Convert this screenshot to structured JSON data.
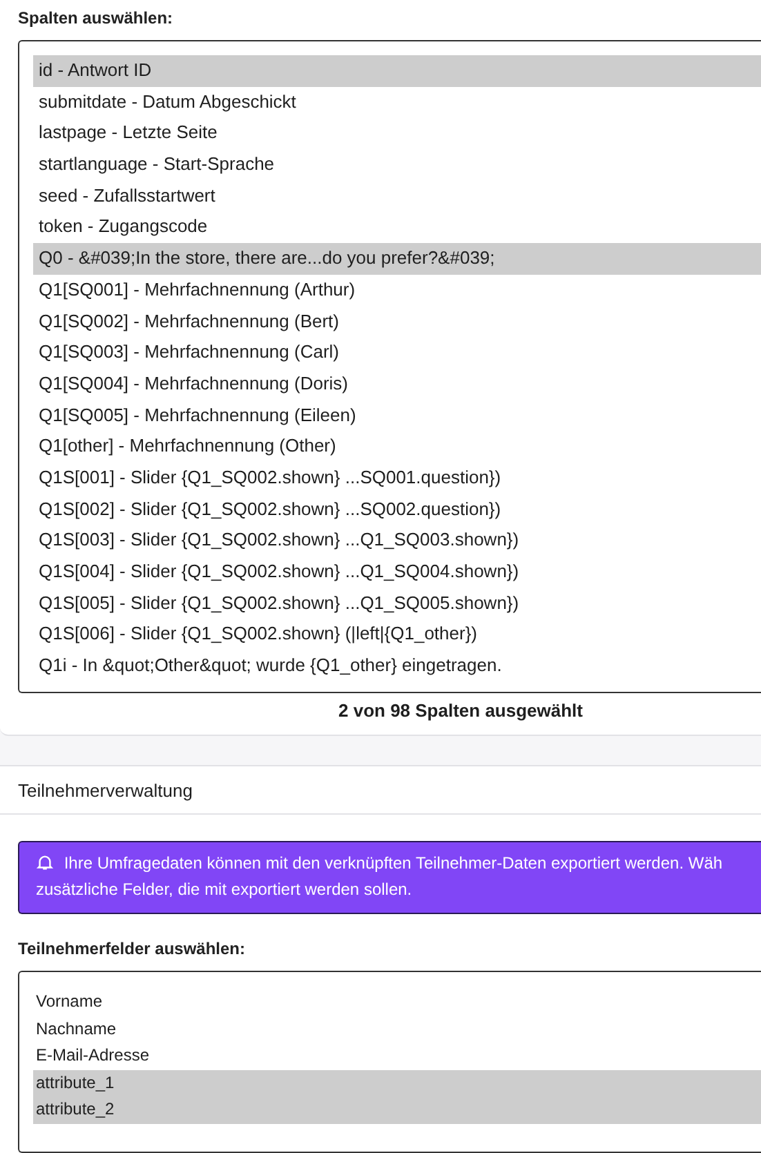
{
  "columns_section": {
    "label": "Spalten auswählen:",
    "options": [
      {
        "text": "id - Antwort ID",
        "selected": true
      },
      {
        "text": "submitdate - Datum Abgeschickt",
        "selected": false
      },
      {
        "text": "lastpage - Letzte Seite",
        "selected": false
      },
      {
        "text": "startlanguage - Start-Sprache",
        "selected": false
      },
      {
        "text": "seed - Zufallsstartwert",
        "selected": false
      },
      {
        "text": "token - Zugangscode",
        "selected": false
      },
      {
        "text": "Q0 - &#039;In the store, there are...do you prefer?&#039;",
        "selected": true
      },
      {
        "text": "Q1[SQ001] - Mehrfachnennung (Arthur)",
        "selected": false
      },
      {
        "text": "Q1[SQ002] - Mehrfachnennung (Bert)",
        "selected": false
      },
      {
        "text": "Q1[SQ003] - Mehrfachnennung (Carl)",
        "selected": false
      },
      {
        "text": "Q1[SQ004] - Mehrfachnennung (Doris)",
        "selected": false
      },
      {
        "text": "Q1[SQ005] - Mehrfachnennung (Eileen)",
        "selected": false
      },
      {
        "text": "Q1[other] - Mehrfachnennung (Other)",
        "selected": false
      },
      {
        "text": "Q1S[001] - Slider {Q1_SQ002.shown} ...SQ001.question})",
        "selected": false
      },
      {
        "text": "Q1S[002] - Slider {Q1_SQ002.shown} ...SQ002.question})",
        "selected": false
      },
      {
        "text": "Q1S[003] - Slider {Q1_SQ002.shown} ...Q1_SQ003.shown})",
        "selected": false
      },
      {
        "text": "Q1S[004] - Slider {Q1_SQ002.shown} ...Q1_SQ004.shown})",
        "selected": false
      },
      {
        "text": "Q1S[005] - Slider {Q1_SQ002.shown} ...Q1_SQ005.shown})",
        "selected": false
      },
      {
        "text": "Q1S[006] - Slider {Q1_SQ002.shown} (|left|{Q1_other})",
        "selected": false
      },
      {
        "text": "Q1i - In &quot;Other&quot; wurde {Q1_other} eingetragen.",
        "selected": false
      }
    ],
    "count": "2 von 98 Spalten ausgewählt"
  },
  "participants_section": {
    "title": "Teilnehmerverwaltung",
    "alert": [
      "Ihre Umfragedaten können mit den verknüpften Teilnehmer-Daten exportiert werden. Wäh",
      "zusätzliche Felder, die mit exportiert werden sollen."
    ],
    "label": "Teilnehmerfelder auswählen:",
    "options": [
      {
        "text": "Vorname",
        "selected": false
      },
      {
        "text": "Nachname",
        "selected": false
      },
      {
        "text": "E-Mail-Adresse",
        "selected": false
      },
      {
        "text": "attribute_1",
        "selected": true
      },
      {
        "text": "attribute_2",
        "selected": true
      }
    ]
  }
}
